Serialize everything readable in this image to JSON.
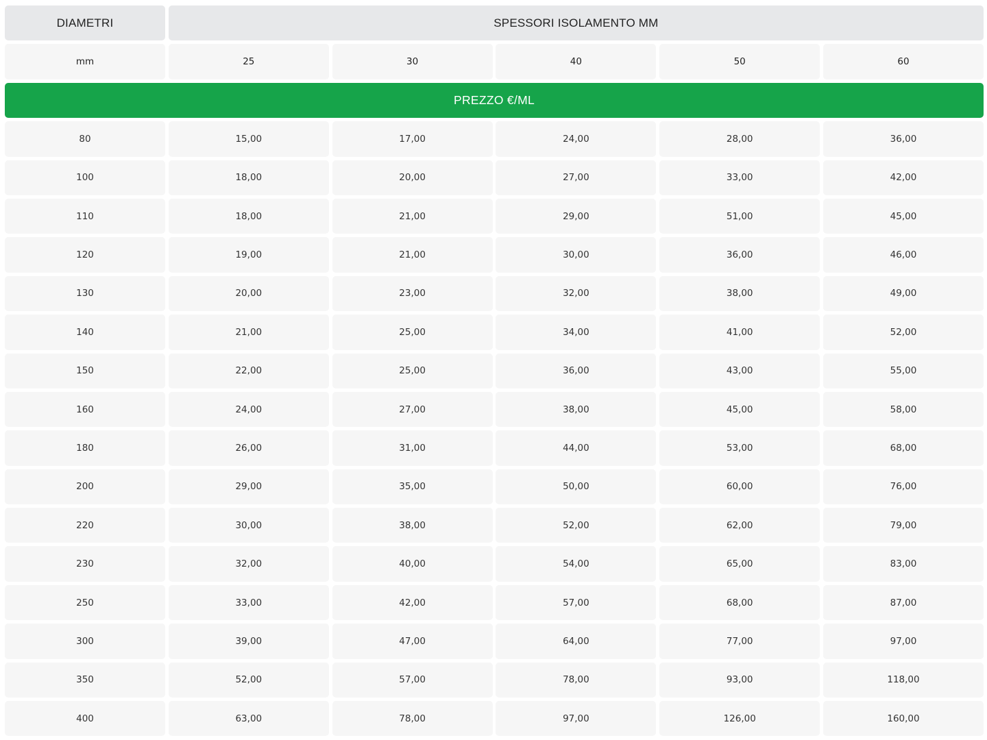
{
  "table": {
    "header_diameter": "DIAMETRI",
    "header_thickness": "SPESSORI ISOLAMENTO MM",
    "unit": "mm",
    "thicknesses": [
      "25",
      "30",
      "40",
      "50",
      "60"
    ],
    "price_label": "PREZZO €/ML",
    "rows": [
      {
        "diameter": "80",
        "prices": [
          "15,00",
          "17,00",
          "24,00",
          "28,00",
          "36,00"
        ]
      },
      {
        "diameter": "100",
        "prices": [
          "18,00",
          "20,00",
          "27,00",
          "33,00",
          "42,00"
        ]
      },
      {
        "diameter": "110",
        "prices": [
          "18,00",
          "21,00",
          "29,00",
          "51,00",
          "45,00"
        ]
      },
      {
        "diameter": "120",
        "prices": [
          "19,00",
          "21,00",
          "30,00",
          "36,00",
          "46,00"
        ]
      },
      {
        "diameter": "130",
        "prices": [
          "20,00",
          "23,00",
          "32,00",
          "38,00",
          "49,00"
        ]
      },
      {
        "diameter": "140",
        "prices": [
          "21,00",
          "25,00",
          "34,00",
          "41,00",
          "52,00"
        ]
      },
      {
        "diameter": "150",
        "prices": [
          "22,00",
          "25,00",
          "36,00",
          "43,00",
          "55,00"
        ]
      },
      {
        "diameter": "160",
        "prices": [
          "24,00",
          "27,00",
          "38,00",
          "45,00",
          "58,00"
        ]
      },
      {
        "diameter": "180",
        "prices": [
          "26,00",
          "31,00",
          "44,00",
          "53,00",
          "68,00"
        ]
      },
      {
        "diameter": "200",
        "prices": [
          "29,00",
          "35,00",
          "50,00",
          "60,00",
          "76,00"
        ]
      },
      {
        "diameter": "220",
        "prices": [
          "30,00",
          "38,00",
          "52,00",
          "62,00",
          "79,00"
        ]
      },
      {
        "diameter": "230",
        "prices": [
          "32,00",
          "40,00",
          "54,00",
          "65,00",
          "83,00"
        ]
      },
      {
        "diameter": "250",
        "prices": [
          "33,00",
          "42,00",
          "57,00",
          "68,00",
          "87,00"
        ]
      },
      {
        "diameter": "300",
        "prices": [
          "39,00",
          "47,00",
          "64,00",
          "77,00",
          "97,00"
        ]
      },
      {
        "diameter": "350",
        "prices": [
          "52,00",
          "57,00",
          "78,00",
          "93,00",
          "118,00"
        ]
      },
      {
        "diameter": "400",
        "prices": [
          "63,00",
          "78,00",
          "97,00",
          "126,00",
          "160,00"
        ]
      }
    ]
  },
  "colors": {
    "accent_green": "#16a44a",
    "header_bg": "#e7e8ea",
    "cell_bg": "#f6f6f6"
  }
}
